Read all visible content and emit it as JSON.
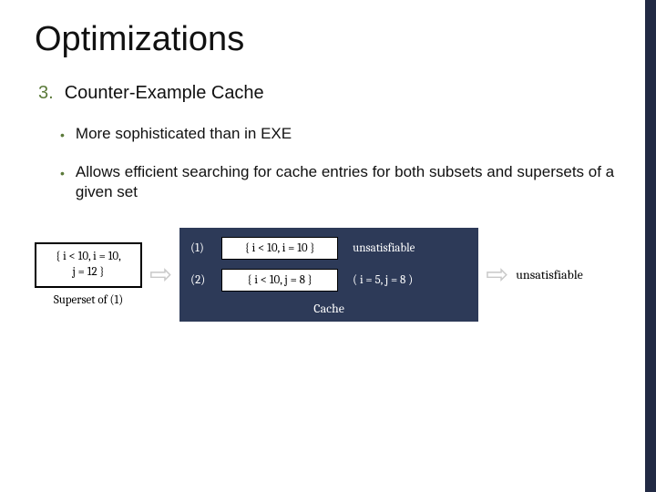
{
  "title": "Optimizations",
  "item_number": "3.",
  "item_label": "Counter-Example Cache",
  "bullets": [
    "More sophisticated than in EXE",
    "Allows efficient searching for cache entries for both subsets and supersets of a given set"
  ],
  "query": {
    "set_line1": "{ i < 10, i = 10,",
    "set_line2": "j = 12 }",
    "caption": "Superset of (1)"
  },
  "cache": {
    "rows": [
      {
        "idx": "(1)",
        "set": "{ i < 10, i = 10 }",
        "res": "unsatisfiable"
      },
      {
        "idx": "(2)",
        "set": "{ i < 10, j = 8 }",
        "res": "( i = 5, j = 8 )"
      }
    ],
    "label": "Cache"
  },
  "result": "unsatisfiable"
}
